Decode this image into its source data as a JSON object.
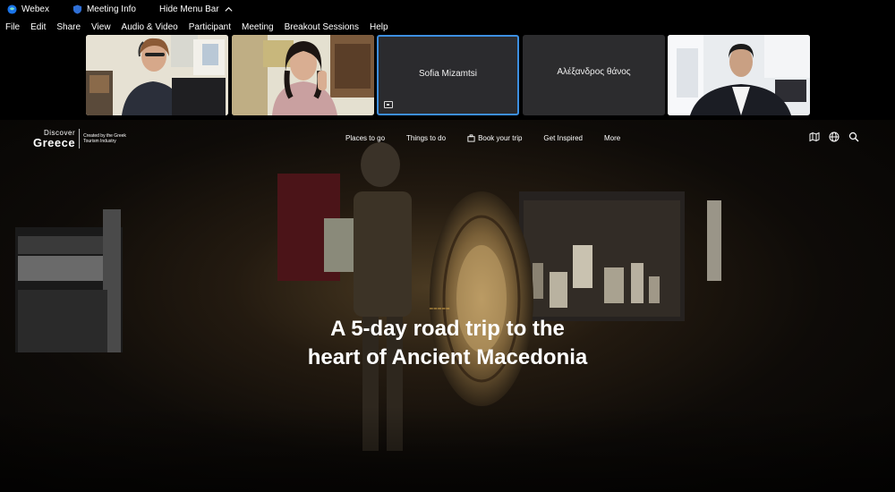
{
  "titlebar": {
    "app_name": "Webex",
    "meeting_info": "Meeting Info",
    "hide_menu": "Hide Menu Bar"
  },
  "menu": [
    {
      "label": "File"
    },
    {
      "label": "Edit"
    },
    {
      "label": "Share"
    },
    {
      "label": "View"
    },
    {
      "label": "Audio & Video"
    },
    {
      "label": "Participant"
    },
    {
      "label": "Meeting"
    },
    {
      "label": "Breakout Sessions"
    },
    {
      "label": "Help"
    }
  ],
  "participants": [
    {
      "name": "",
      "video": true
    },
    {
      "name": "",
      "video": true
    },
    {
      "name": "Sofia Mizamtsi",
      "video": false,
      "active": true
    },
    {
      "name": "Αλέξανδρος θάνος",
      "video": false
    },
    {
      "name": "",
      "video": true
    }
  ],
  "site": {
    "logo_small": "Discover",
    "logo_big": "Greece",
    "logo_tagline": "Created by the Greek Tourism Industry",
    "nav": [
      "Places to go",
      "Things to do",
      "Book your trip",
      "Get Inspired",
      "More"
    ],
    "tools": [
      "map-icon",
      "globe-icon",
      "search-icon"
    ]
  },
  "hero": {
    "headline_line1": "A 5-day road trip to the",
    "headline_line2": "heart of Ancient Macedonia"
  },
  "colors": {
    "active_border": "#3d8fe0",
    "tile_bg": "#2c2c2e"
  }
}
